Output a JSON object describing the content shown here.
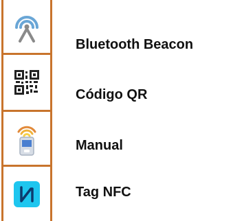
{
  "items": [
    {
      "label": "Bluetooth Beacon",
      "icon": "bluetooth-beacon-icon"
    },
    {
      "label": "Código QR",
      "icon": "qr-code-icon"
    },
    {
      "label": "Manual",
      "icon": "manual-device-icon"
    },
    {
      "label": "Tag NFC",
      "icon": "nfc-tag-icon"
    }
  ],
  "colors": {
    "border": "#c8742c",
    "beacon": "#6aa6d6",
    "nfc": "#1ec6ef",
    "text": "#111111"
  }
}
